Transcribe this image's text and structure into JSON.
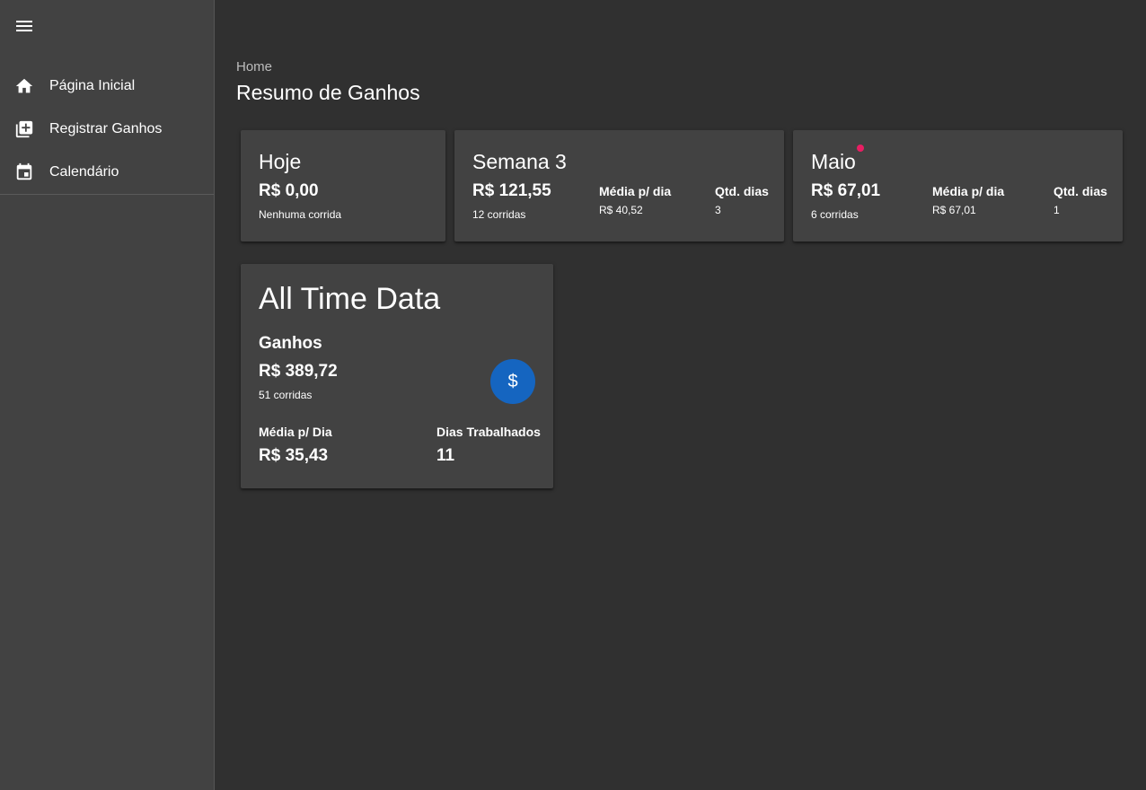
{
  "sidebar": {
    "items": [
      {
        "label": "Página Inicial",
        "icon": "home-icon"
      },
      {
        "label": "Registrar Ganhos",
        "icon": "add-library-icon"
      },
      {
        "label": "Calendário",
        "icon": "calendar-icon"
      }
    ]
  },
  "header": {
    "breadcrumb": "Home",
    "title": "Resumo de Ganhos"
  },
  "cards": {
    "today": {
      "title": "Hoje",
      "amount": "R$ 0,00",
      "rides": "Nenhuma corrida"
    },
    "week": {
      "title": "Semana 3",
      "amount": "R$ 121,55",
      "rides": "12 corridas",
      "avg_label": "Média p/ dia",
      "avg_value": "R$ 40,52",
      "days_label": "Qtd. dias",
      "days_value": "3"
    },
    "month": {
      "title": "Maio",
      "amount": "R$ 67,01",
      "rides": "6 corridas",
      "avg_label": "Média p/ dia",
      "avg_value": "R$ 67,01",
      "days_label": "Qtd. dias",
      "days_value": "1"
    },
    "all_time": {
      "title": "All Time Data",
      "earnings_label": "Ganhos",
      "amount": "R$ 389,72",
      "rides": "51 corridas",
      "avg_label": "Média p/ Dia",
      "avg_value": "R$ 35,43",
      "days_label": "Dias Trabalhados",
      "days_value": "11",
      "fab_symbol": "$"
    }
  },
  "colors": {
    "background": "#303030",
    "surface": "#424242",
    "accent_dot": "#e91e63",
    "fab": "#1565c0"
  }
}
